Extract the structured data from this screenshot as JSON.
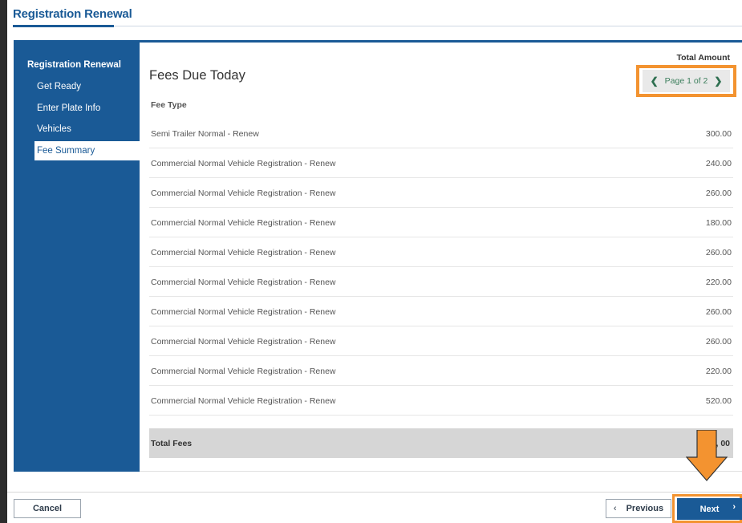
{
  "app": {
    "title": "Registration Renewal"
  },
  "sidebar": {
    "heading": "Registration Renewal",
    "items": [
      {
        "label": "Get Ready",
        "active": false
      },
      {
        "label": "Enter Plate Info",
        "active": false
      },
      {
        "label": "Vehicles",
        "active": false
      },
      {
        "label": "Fee Summary",
        "active": true
      }
    ]
  },
  "main": {
    "title": "Fees Due Today",
    "pager": {
      "text": "Page 1 of 2",
      "prev_icon": "chevron-left-icon",
      "next_icon": "chevron-right-icon"
    },
    "columns": {
      "fee_type": "Fee Type",
      "total_amount": "Total Amount"
    },
    "rows": [
      {
        "fee_type": "Semi Trailer Normal - Renew",
        "amount": "300.00"
      },
      {
        "fee_type": "Commercial Normal Vehicle Registration - Renew",
        "amount": "240.00"
      },
      {
        "fee_type": "Commercial Normal Vehicle Registration - Renew",
        "amount": "260.00"
      },
      {
        "fee_type": "Commercial Normal Vehicle Registration - Renew",
        "amount": "180.00"
      },
      {
        "fee_type": "Commercial Normal Vehicle Registration - Renew",
        "amount": "260.00"
      },
      {
        "fee_type": "Commercial Normal Vehicle Registration - Renew",
        "amount": "220.00"
      },
      {
        "fee_type": "Commercial Normal Vehicle Registration - Renew",
        "amount": "260.00"
      },
      {
        "fee_type": "Commercial Normal Vehicle Registration - Renew",
        "amount": "260.00"
      },
      {
        "fee_type": "Commercial Normal Vehicle Registration - Renew",
        "amount": "220.00"
      },
      {
        "fee_type": "Commercial Normal Vehicle Registration - Renew",
        "amount": "520.00"
      }
    ],
    "total": {
      "label": "Total Fees",
      "amount": "2,  00"
    }
  },
  "footer": {
    "cancel_label": "Cancel",
    "previous_label": "Previous",
    "next_label": "Next"
  },
  "colors": {
    "brand_blue": "#1a5a96",
    "highlight_orange": "#f39330",
    "pager_green": "#2e6f50"
  },
  "annotations": {
    "arrow": "down-arrow-icon"
  }
}
